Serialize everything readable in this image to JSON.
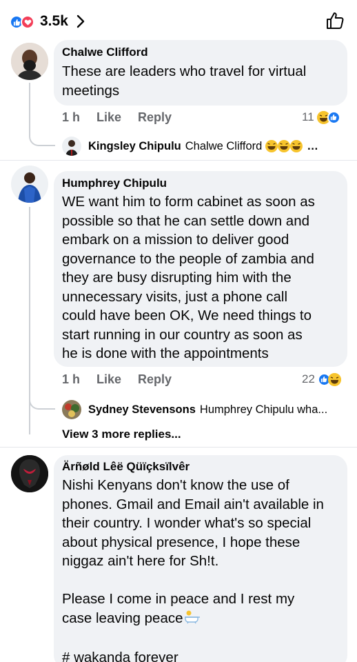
{
  "header": {
    "reaction_count": "3.5k"
  },
  "comments": [
    {
      "author": "Chalwe Clifford",
      "text_lines": [
        "These are leaders who travel for virtual",
        "meetings"
      ],
      "time": "1 h",
      "like_label": "Like",
      "reply_label": "Reply",
      "reaction_count": "11",
      "reply_preview": {
        "author": "Kingsley Chipulu",
        "text": "Chalwe Clifford"
      }
    },
    {
      "author": "Humphrey Chipulu",
      "text_lines": [
        "WE want him to form cabinet as soon as",
        "possible so that he can settle down and",
        "embark on a mission to deliver good",
        "governance to the people of zambia and",
        "they are busy disrupting him with the",
        "unnecessary visits,  just a phone call",
        "could have been OK, We need things to",
        "start running in our country as soon as",
        "he is done with the appointments"
      ],
      "time": "1 h",
      "like_label": "Like",
      "reply_label": "Reply",
      "reaction_count": "22",
      "reply_preview": {
        "author": "Sydney Stevensons",
        "text": "Humphrey Chipulu wha..."
      },
      "more_replies": "View 3 more replies..."
    },
    {
      "author": "Ärñøld Lêë Qüïçksïlvêr",
      "text_lines": [
        "Nishi Kenyans don't know the use of",
        "phones. Gmail and Email ain't available in",
        "their country. I wonder what's so special",
        "about physical presence, I hope these",
        "niggaz ain't here for Sh!t.",
        "",
        "Please I come in peace and I rest my",
        "case leaving peace",
        "",
        "# wakanda forever"
      ]
    }
  ],
  "colors": {
    "like_blue": "#1877f2",
    "love_red": "#f33e58",
    "bubble_bg": "#f0f2f5",
    "secondary_text": "#65676b"
  }
}
